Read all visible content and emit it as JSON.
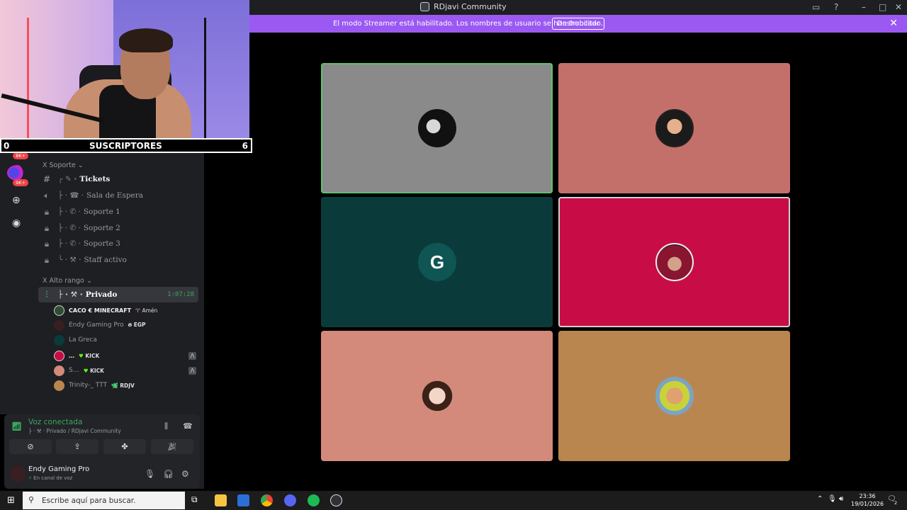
{
  "window": {
    "title": "RDjavi Community",
    "controls": [
      "▭",
      "?",
      "–",
      "□",
      "✕"
    ]
  },
  "banner": {
    "message": "El modo Streamer está habilitado. Los nombres de usuario se han truncado.",
    "button": "Deshabilitar",
    "close": "✕"
  },
  "overlay": {
    "label": "SUSCRIPTORES",
    "count": "6",
    "left_value": "0"
  },
  "guilds": {
    "badges": [
      "8K+",
      "9K+"
    ]
  },
  "sidebar": {
    "categories": [
      {
        "label": "Soporte"
      },
      {
        "label": "Alto rango"
      }
    ],
    "channels": [
      {
        "label": "Tickets"
      },
      {
        "label": "Sala de Espera"
      },
      {
        "label": "Soporte 1"
      },
      {
        "label": "Soporte 2"
      },
      {
        "label": "Soporte 3"
      },
      {
        "label": "Staff activo"
      },
      {
        "label": "Privado",
        "time": "1:07:28"
      }
    ],
    "members": [
      {
        "name": "CACO € MINECRAFT",
        "tag": "Amén"
      },
      {
        "name": "Endy Gaming Pro",
        "tag": "EGP"
      },
      {
        "name": "La Greca",
        "tag": ""
      },
      {
        "name": "…",
        "tag": "KICK"
      },
      {
        "name": "S…",
        "tag": "KICK"
      },
      {
        "name": "Trinity-_ TTT",
        "tag": "RDJV"
      }
    ]
  },
  "voice": {
    "status": "Voz conectada",
    "channel": "Privado / RDjavi Community"
  },
  "user": {
    "name": "Endy Gaming Pro",
    "status": "En canal de voz"
  },
  "tiles": [
    {
      "bg": "#8a8a8a",
      "state": "speaking"
    },
    {
      "bg": "#c4706a",
      "state": ""
    },
    {
      "bg": "#0a3b3a",
      "state": ""
    },
    {
      "bg": "#c80d46",
      "state": "border"
    },
    {
      "bg": "#d38a7a",
      "state": ""
    },
    {
      "bg": "#b98650",
      "state": ""
    }
  ],
  "taskbar": {
    "search_placeholder": "Escribe aquí para buscar.",
    "time": "23:36",
    "date": "19/01/2026",
    "notifications": "2"
  },
  "colors": {
    "accent": "#9b59f2",
    "connected": "#3ba55d"
  }
}
